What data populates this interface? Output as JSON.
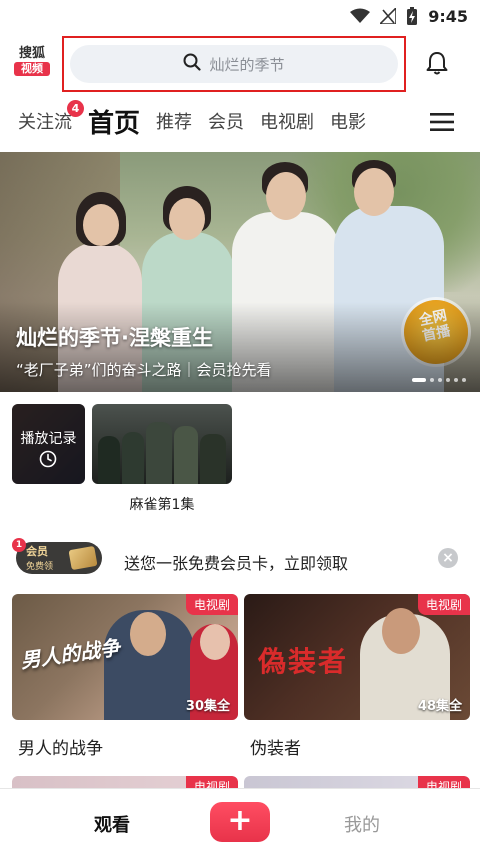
{
  "status_bar": {
    "time": "9:45"
  },
  "header": {
    "logo_top": "搜狐",
    "logo_bottom": "视频",
    "search_placeholder": "灿烂的季节"
  },
  "tabs": [
    {
      "label": "关注流",
      "badge": "4"
    },
    {
      "label": "首页",
      "active": true
    },
    {
      "label": "推荐"
    },
    {
      "label": "会员"
    },
    {
      "label": "电视剧"
    },
    {
      "label": "电影"
    }
  ],
  "banner": {
    "title": "灿烂的季节·涅槃重生",
    "subtitle": "“老厂子弟”们的奋斗之路｜会员抢先看",
    "badge_line1": "全网",
    "badge_line2": "首播"
  },
  "history": {
    "label": "播放记录",
    "item_title": "麻雀第1集"
  },
  "promo": {
    "card_title": "会员",
    "card_sub": "免费领",
    "badge": "1",
    "text": "送您一张免费会员卡，立即领取"
  },
  "cards": [
    {
      "title": "男人的战争",
      "tag": "电视剧",
      "episodes": "30集全",
      "poster_text": "男人的战争"
    },
    {
      "title": "伪装者",
      "tag": "电视剧",
      "episodes": "48集全",
      "poster_text": "偽装者"
    }
  ],
  "peek_cards": [
    {
      "tag": "电视剧"
    },
    {
      "tag": "电视剧"
    }
  ],
  "bottom_nav": {
    "watch": "观看",
    "add": "+",
    "mine": "我的"
  },
  "colors": {
    "brand": "#e8334a",
    "highlight_frame": "#e02020"
  }
}
